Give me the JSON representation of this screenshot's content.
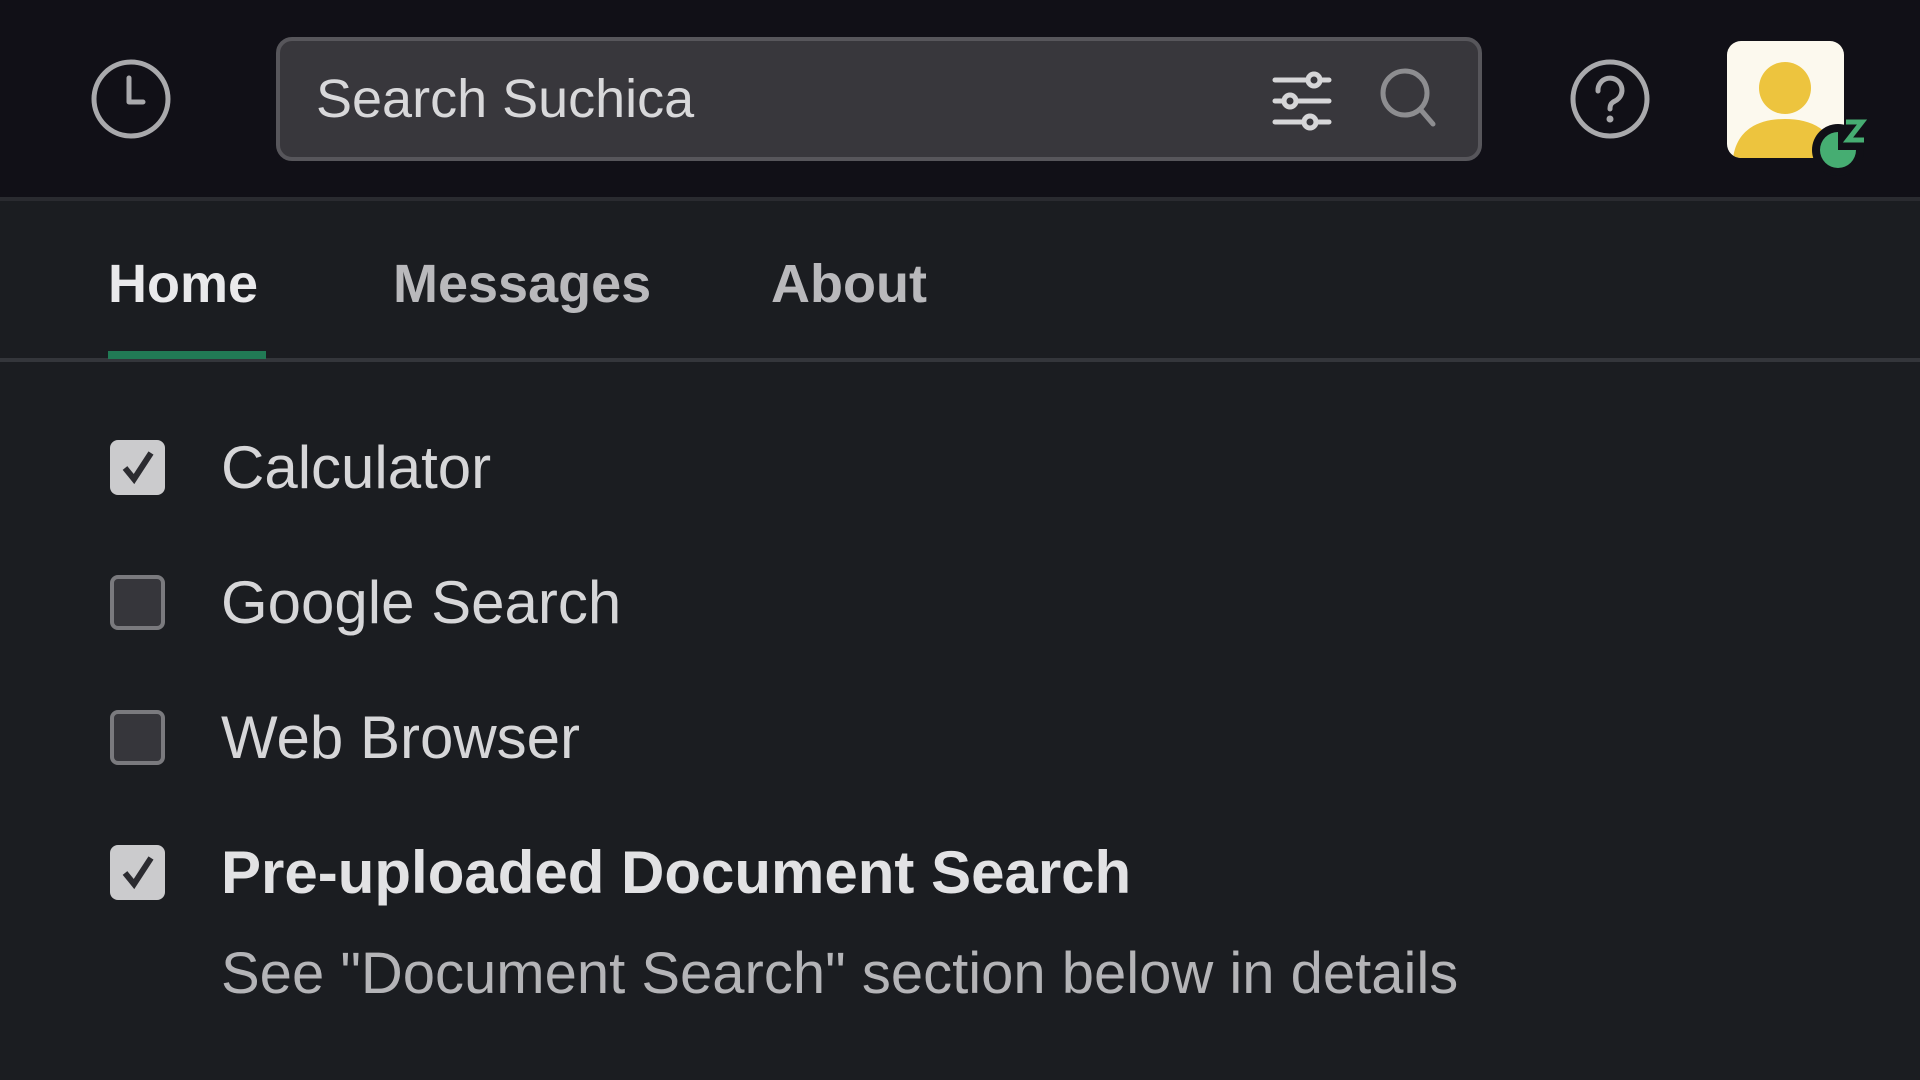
{
  "header": {
    "history_icon": "clock-icon",
    "search": {
      "placeholder": "Search Suchica",
      "value": "",
      "filter_icon": "sliders-icon",
      "search_icon": "magnifier-icon"
    },
    "help_icon": "question-circle-icon",
    "avatar": {
      "icon": "user-silhouette-icon",
      "status": "away-snooze",
      "status_icon": "snooze-moon-icon",
      "colors": {
        "background": "#fcf9ee",
        "figure": "#edc43e",
        "status": "#46ad72"
      }
    }
  },
  "tabs": [
    {
      "label": "Home",
      "active": true
    },
    {
      "label": "Messages",
      "active": false
    },
    {
      "label": "About",
      "active": false
    }
  ],
  "accent_color": "#217a55",
  "options": [
    {
      "label": "Calculator",
      "checked": true
    },
    {
      "label": "Google Search",
      "checked": false
    },
    {
      "label": "Web Browser",
      "checked": false
    },
    {
      "label": "Pre-uploaded Document Search",
      "checked": true,
      "description": "See \"Document Search\" section below in details"
    }
  ]
}
